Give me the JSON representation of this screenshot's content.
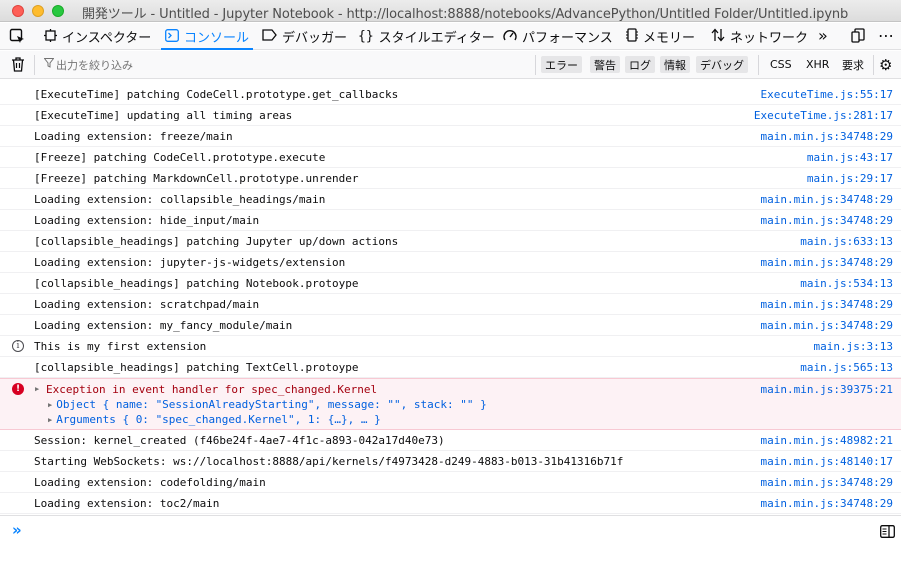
{
  "window": {
    "title": "開発ツール - Untitled - Jupyter Notebook - http://localhost:8888/notebooks/AdvancePython/Untitled Folder/Untitled.ipynb"
  },
  "tabs": [
    {
      "label": "インスペクター",
      "icon": "inspector-icon"
    },
    {
      "label": "コンソール",
      "icon": "console-icon",
      "active": true
    },
    {
      "label": "デバッガー",
      "icon": "debugger-icon"
    },
    {
      "label": "スタイルエディター",
      "icon": "style-editor-icon"
    },
    {
      "label": "パフォーマンス",
      "icon": "performance-icon"
    },
    {
      "label": "メモリー",
      "icon": "memory-icon"
    },
    {
      "label": "ネットワーク",
      "icon": "network-icon"
    }
  ],
  "filterbar": {
    "placeholder": "出力を絞り込み",
    "buttons": [
      "エラー",
      "警告",
      "ログ",
      "情報",
      "デバッグ"
    ],
    "plain_buttons": [
      "CSS",
      "XHR",
      "要求"
    ]
  },
  "log": [
    {
      "msg": "[ExecuteTime] patching CodeCell.prototype.get_callbacks",
      "src": "ExecuteTime.js:55:17"
    },
    {
      "msg": "[ExecuteTime] updating all timing areas",
      "src": "ExecuteTime.js:281:17"
    },
    {
      "msg": "Loading extension: freeze/main",
      "src": "main.min.js:34748:29"
    },
    {
      "msg": "[Freeze] patching CodeCell.prototype.execute",
      "src": "main.js:43:17"
    },
    {
      "msg": "[Freeze] patching MarkdownCell.prototype.unrender",
      "src": "main.js:29:17"
    },
    {
      "msg": "Loading extension: collapsible_headings/main",
      "src": "main.min.js:34748:29"
    },
    {
      "msg": "Loading extension: hide_input/main",
      "src": "main.min.js:34748:29"
    },
    {
      "msg": "[collapsible_headings] patching Jupyter up/down actions",
      "src": "main.js:633:13"
    },
    {
      "msg": "Loading extension: jupyter-js-widgets/extension",
      "src": "main.min.js:34748:29"
    },
    {
      "msg": "[collapsible_headings] patching Notebook.protoype",
      "src": "main.js:534:13"
    },
    {
      "msg": "Loading extension: scratchpad/main",
      "src": "main.min.js:34748:29"
    },
    {
      "msg": "Loading extension: my_fancy_module/main",
      "src": "main.min.js:34748:29"
    },
    {
      "msg": "This is my first extension",
      "src": "main.js:3:13",
      "type": "info"
    },
    {
      "msg": "[collapsible_headings] patching TextCell.protoype",
      "src": "main.js:565:13"
    }
  ],
  "error": {
    "msg": "Exception in event handler for spec_changed.Kernel",
    "src": "main.min.js:39375:21",
    "line1_pre": "Object { name: ",
    "line1_name": "\"SessionAlreadyStarting\"",
    "line1_mid": ", message: ",
    "line1_message": "\"\"",
    "line1_mid2": ", stack: ",
    "line1_stack": "\"\"",
    "line1_end": " }",
    "line2_pre": "Arguments { 0: ",
    "line2_val": "\"spec_changed.Kernel\"",
    "line2_end": ", 1: {…}, … }"
  },
  "log2": [
    {
      "msg": "Session: kernel_created (f46be24f-4ae7-4f1c-a893-042a17d40e73)",
      "src": "main.min.js:48982:21"
    },
    {
      "msg": "Starting WebSockets: ws://localhost:8888/api/kernels/f4973428-d249-4883-b013-31b41316b71f",
      "src": "main.min.js:48140:17"
    },
    {
      "msg": "Loading extension: codefolding/main",
      "src": "main.min.js:34748:29"
    },
    {
      "msg": "Loading extension: toc2/main",
      "src": "main.min.js:34748:29"
    }
  ],
  "input": {
    "prompt": "»"
  }
}
